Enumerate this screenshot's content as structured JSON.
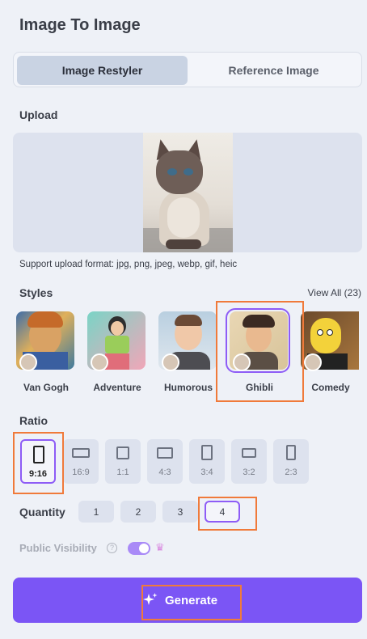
{
  "header": {
    "title": "Image To Image"
  },
  "tabs": [
    {
      "label": "Image Restyler",
      "active": true
    },
    {
      "label": "Reference Image",
      "active": false
    }
  ],
  "upload": {
    "label": "Upload",
    "formats": "Support upload format: jpg, png, jpeg, webp, gif, heic"
  },
  "styles": {
    "label": "Styles",
    "view_all": "View All (23)",
    "items": [
      {
        "label": "Van Gogh",
        "selected": false
      },
      {
        "label": "Adventure",
        "selected": false
      },
      {
        "label": "Humorous",
        "selected": false
      },
      {
        "label": "Ghibli",
        "selected": true
      },
      {
        "label": "Comedy",
        "selected": false
      }
    ]
  },
  "ratio": {
    "label": "Ratio",
    "options": [
      "9:16",
      "16:9",
      "1:1",
      "4:3",
      "3:4",
      "3:2",
      "2:3"
    ],
    "selected": "9:16"
  },
  "quantity": {
    "label": "Quantity",
    "options": [
      "1",
      "2",
      "3",
      "4"
    ],
    "selected": "4"
  },
  "visibility": {
    "label": "Public Visibility",
    "help": "?",
    "enabled": true
  },
  "generate": {
    "label": "Generate"
  },
  "colors": {
    "accent": "#7b55f5",
    "highlight": "#f07a3a",
    "selected_border": "#8e5cf6",
    "background": "#eef1f7"
  }
}
